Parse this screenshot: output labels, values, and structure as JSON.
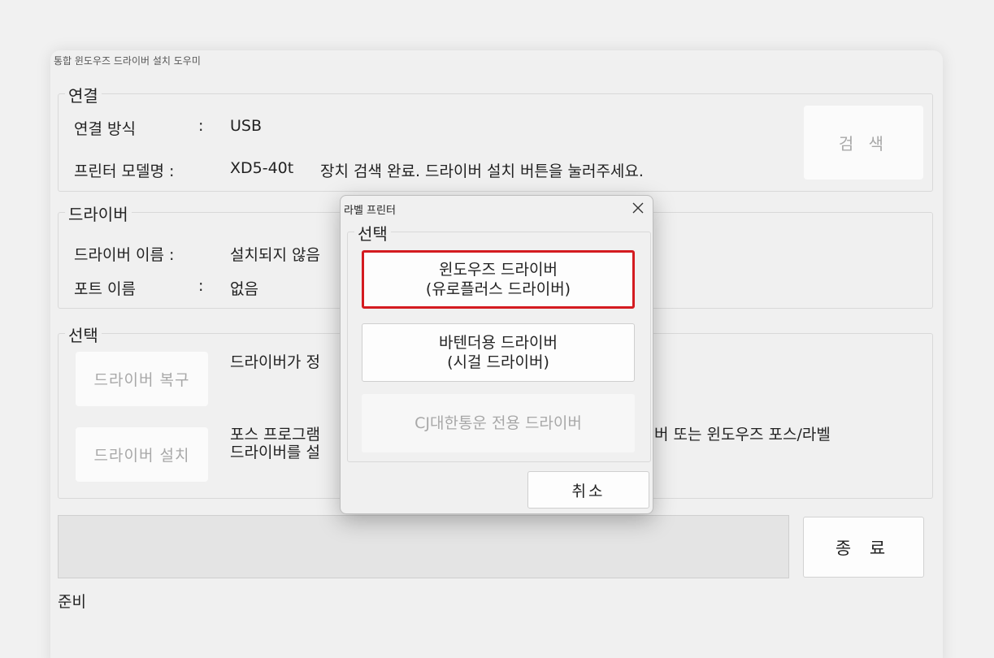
{
  "window": {
    "title": "통합 윈도우즈 드라이버 설치 도우미"
  },
  "connection": {
    "legend": "연결",
    "method_label": "연결 방식",
    "method_colon": ":",
    "method_value": "USB",
    "model_label": "프린터 모델명 :",
    "model_value": "XD5-40t",
    "status_message": "장치 검색 완료. 드라이버 설치 버튼을 눌러주세요.",
    "search_button": "검  색"
  },
  "driver": {
    "legend": "드라이버",
    "name_label": "드라이버 이름 :",
    "name_value": "설치되지 않음",
    "port_label": "포트 이름",
    "port_colon": ":",
    "port_value": "없음"
  },
  "selection": {
    "legend": "선택",
    "restore_button": "드라이버 복구",
    "restore_desc": "드라이버가 정",
    "install_button": "드라이버 설치",
    "install_desc_line1": "포스 프로그램",
    "install_desc_line1b": "버 또는 윈도우즈 포스/라벨",
    "install_desc_line2": "드라이버를 설"
  },
  "footer": {
    "exit_button": "종 료",
    "status": "준비"
  },
  "dialog": {
    "title": "라벨 프린터",
    "close_icon": "close-icon",
    "legend": "선택",
    "option1_line1": "윈도우즈 드라이버",
    "option1_line2": "(유로플러스 드라이버)",
    "option2_line1": "바텐더용 드라이버",
    "option2_line2": "(시걸 드라이버)",
    "option3": "CJ대한통운 전용 드라이버",
    "cancel_button": "취소"
  },
  "colors": {
    "highlight": "#d41b20",
    "disabled_text": "#a8a8a8",
    "background": "#f0f0f0"
  }
}
